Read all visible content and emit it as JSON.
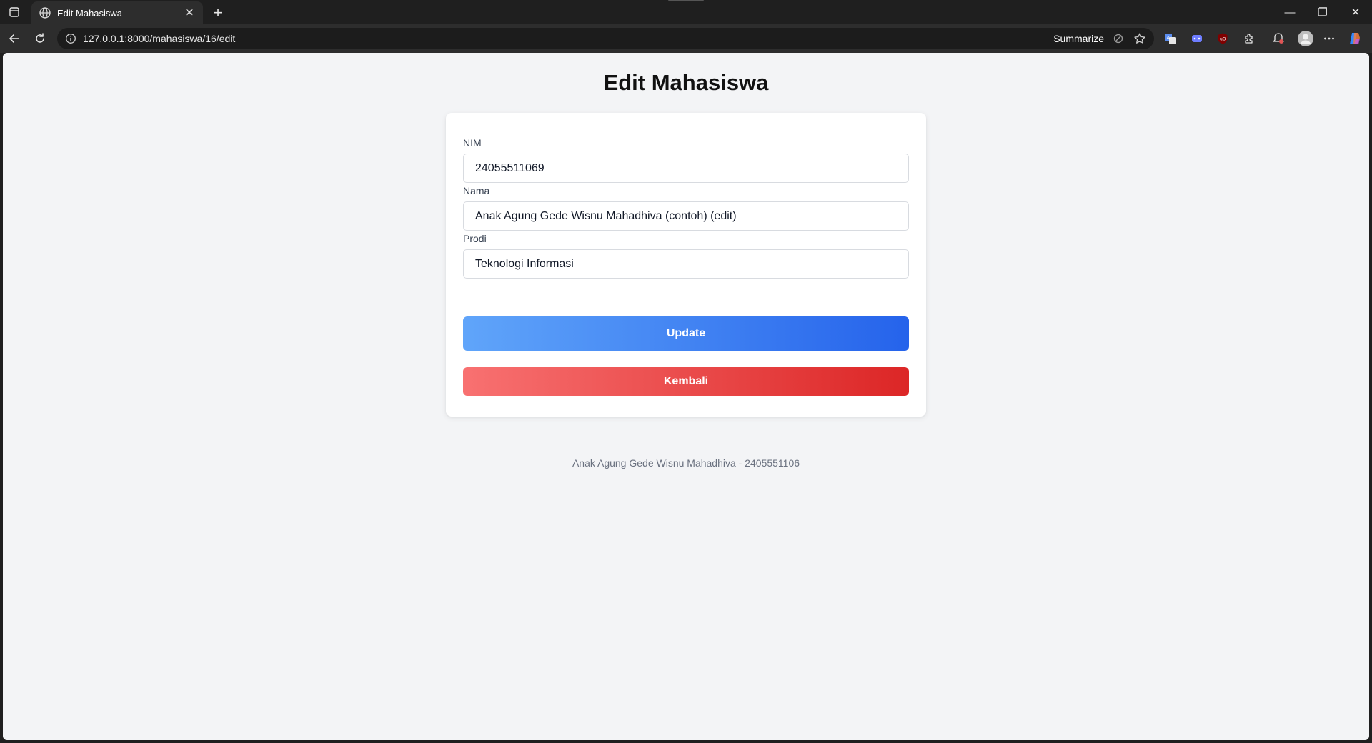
{
  "browser": {
    "tab": {
      "title": "Edit Mahasiswa",
      "close_glyph": "✕",
      "icon": "globe-icon"
    },
    "new_tab_glyph": "+",
    "address": {
      "url": "127.0.0.1:8000/mahasiswa/16/edit",
      "summarize_label": "Summarize"
    },
    "window_controls": {
      "minimize": "—",
      "restore": "❐",
      "close": "✕"
    }
  },
  "page": {
    "title": "Edit Mahasiswa",
    "form": {
      "nim": {
        "label": "NIM",
        "value": "24055511069"
      },
      "nama": {
        "label": "Nama",
        "value": "Anak Agung Gede Wisnu Mahadhiva (contoh) (edit)"
      },
      "prodi": {
        "label": "Prodi",
        "value": "Teknologi Informasi"
      },
      "update_label": "Update",
      "back_label": "Kembali"
    },
    "footer": "Anak Agung Gede Wisnu Mahadhiva - 2405551106"
  },
  "colors": {
    "page_bg": "#f3f4f6",
    "update_gradient": [
      "#60a5fa",
      "#2563eb"
    ],
    "back_gradient": [
      "#f87171",
      "#dc2626"
    ]
  }
}
